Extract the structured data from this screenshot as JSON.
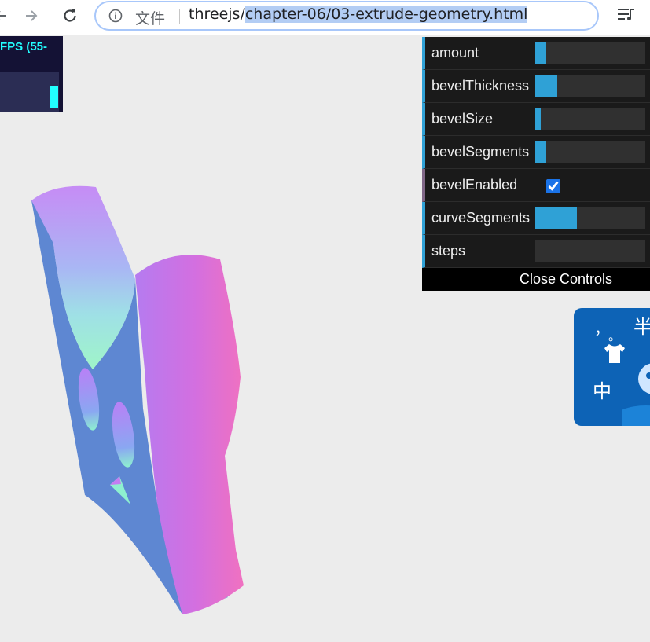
{
  "browser": {
    "site_label": "文件",
    "url_prefix": "threejs/",
    "url_selected": "chapter-06/03-extrude-geometry.html"
  },
  "stats": {
    "fps_text": "FPS (55-"
  },
  "gui": {
    "controls": [
      {
        "label": "amount",
        "type": "slider",
        "level": 0.1
      },
      {
        "label": "bevelThickness",
        "type": "slider",
        "level": 0.2
      },
      {
        "label": "bevelSize",
        "type": "slider",
        "level": 0.05
      },
      {
        "label": "bevelSegments",
        "type": "slider",
        "level": 0.1
      },
      {
        "label": "bevelEnabled",
        "type": "checkbox",
        "checked": true
      },
      {
        "label": "curveSegments",
        "type": "slider",
        "level": 0.38
      },
      {
        "label": "steps",
        "type": "slider",
        "level": 0.0
      }
    ],
    "close_label": "Close Controls"
  },
  "ime": {
    "char_top": "半",
    "char_bottom": "中",
    "punct_comma": "，",
    "punct_period": "。"
  },
  "colors": {
    "gui_accent": "#2fa1d6",
    "stats_text": "#22ffff",
    "canvas_bg": "#ececec"
  }
}
